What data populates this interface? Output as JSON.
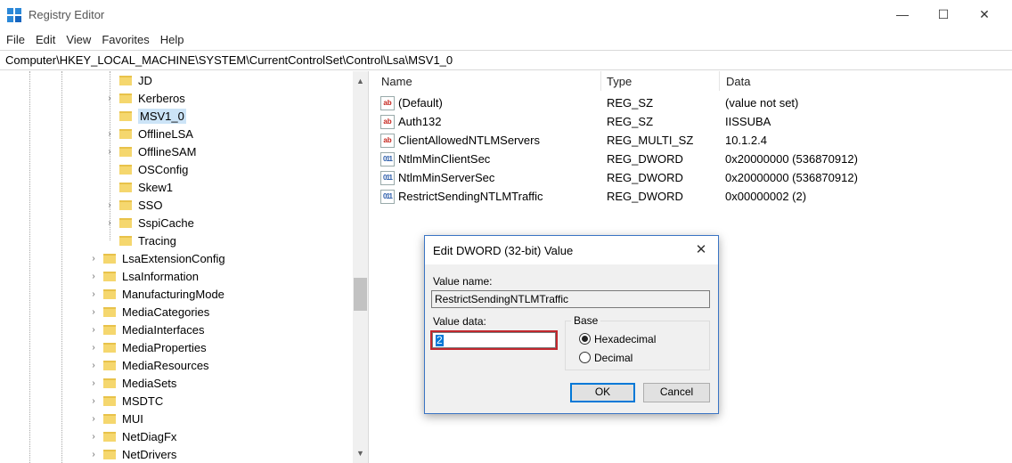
{
  "window": {
    "title": "Registry Editor",
    "minimize": "—",
    "maximize": "☐",
    "close": "✕"
  },
  "menu": [
    "File",
    "Edit",
    "View",
    "Favorites",
    "Help"
  ],
  "address": "Computer\\HKEY_LOCAL_MACHINE\\SYSTEM\\CurrentControlSet\\Control\\Lsa\\MSV1_0",
  "tree": {
    "items": [
      {
        "label": "JD",
        "level": 2,
        "expandable": false,
        "selected": false
      },
      {
        "label": "Kerberos",
        "level": 2,
        "expandable": true,
        "selected": false
      },
      {
        "label": "MSV1_0",
        "level": 2,
        "expandable": false,
        "selected": true
      },
      {
        "label": "OfflineLSA",
        "level": 2,
        "expandable": true,
        "selected": false
      },
      {
        "label": "OfflineSAM",
        "level": 2,
        "expandable": true,
        "selected": false
      },
      {
        "label": "OSConfig",
        "level": 2,
        "expandable": false,
        "selected": false
      },
      {
        "label": "Skew1",
        "level": 2,
        "expandable": false,
        "selected": false
      },
      {
        "label": "SSO",
        "level": 2,
        "expandable": true,
        "selected": false
      },
      {
        "label": "SspiCache",
        "level": 2,
        "expandable": true,
        "selected": false
      },
      {
        "label": "Tracing",
        "level": 2,
        "expandable": false,
        "selected": false
      },
      {
        "label": "LsaExtensionConfig",
        "level": 1,
        "expandable": true,
        "selected": false
      },
      {
        "label": "LsaInformation",
        "level": 1,
        "expandable": true,
        "selected": false
      },
      {
        "label": "ManufacturingMode",
        "level": 1,
        "expandable": true,
        "selected": false
      },
      {
        "label": "MediaCategories",
        "level": 1,
        "expandable": true,
        "selected": false
      },
      {
        "label": "MediaInterfaces",
        "level": 1,
        "expandable": true,
        "selected": false
      },
      {
        "label": "MediaProperties",
        "level": 1,
        "expandable": true,
        "selected": false
      },
      {
        "label": "MediaResources",
        "level": 1,
        "expandable": true,
        "selected": false
      },
      {
        "label": "MediaSets",
        "level": 1,
        "expandable": true,
        "selected": false
      },
      {
        "label": "MSDTC",
        "level": 1,
        "expandable": true,
        "selected": false
      },
      {
        "label": "MUI",
        "level": 1,
        "expandable": true,
        "selected": false
      },
      {
        "label": "NetDiagFx",
        "level": 1,
        "expandable": true,
        "selected": false
      },
      {
        "label": "NetDrivers",
        "level": 1,
        "expandable": true,
        "selected": false
      }
    ],
    "expand_glyph": "›",
    "scroll_up": "▲",
    "scroll_down": "▼"
  },
  "values": {
    "columns": [
      "Name",
      "Type",
      "Data"
    ],
    "rows": [
      {
        "icon": "string-value-icon",
        "name": "(Default)",
        "type": "REG_SZ",
        "data": "(value not set)"
      },
      {
        "icon": "string-value-icon",
        "name": "Auth132",
        "type": "REG_SZ",
        "data": "IISSUBA"
      },
      {
        "icon": "string-value-icon",
        "name": "ClientAllowedNTLMServers",
        "type": "REG_MULTI_SZ",
        "data": "10.1.2.4"
      },
      {
        "icon": "binary-value-icon",
        "name": "NtlmMinClientSec",
        "type": "REG_DWORD",
        "data": "0x20000000 (536870912)"
      },
      {
        "icon": "binary-value-icon",
        "name": "NtlmMinServerSec",
        "type": "REG_DWORD",
        "data": "0x20000000 (536870912)"
      },
      {
        "icon": "binary-value-icon",
        "name": "RestrictSendingNTLMTraffic",
        "type": "REG_DWORD",
        "data": "0x00000002 (2)"
      }
    ],
    "sz_glyph": "ab",
    "dword_glyph": "011"
  },
  "dialog": {
    "title": "Edit DWORD (32-bit) Value",
    "close": "✕",
    "value_name_label": "Value name:",
    "value_name": "RestrictSendingNTLMTraffic",
    "value_data_label": "Value data:",
    "value_data": "2",
    "base_label": "Base",
    "hex_label": "Hexadecimal",
    "dec_label": "Decimal",
    "selected_base": "Hexadecimal",
    "ok": "OK",
    "cancel": "Cancel"
  }
}
